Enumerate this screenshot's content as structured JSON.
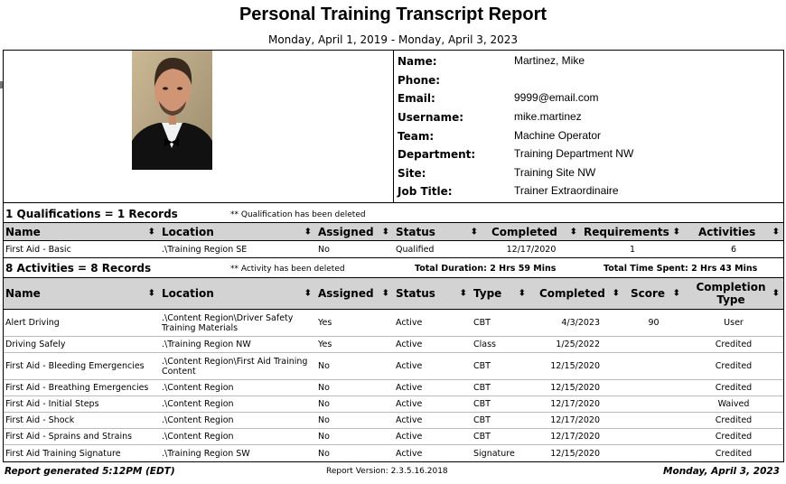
{
  "report": {
    "title": "Personal Training Transcript Report",
    "date_range": "Monday, April 1, 2019 - Monday, April 3, 2023"
  },
  "profile": {
    "fields": [
      {
        "label": "Name:",
        "value": "Martinez, Mike"
      },
      {
        "label": "Phone:",
        "value": ""
      },
      {
        "label": "Email:",
        "value": "9999@email.com"
      },
      {
        "label": "Username:",
        "value": "mike.martinez"
      },
      {
        "label": "Team:",
        "value": "Machine Operator"
      },
      {
        "label": "Department:",
        "value": "Training Department NW"
      },
      {
        "label": "Site:",
        "value": "Training Site NW"
      },
      {
        "label": "Job Title:",
        "value": "Trainer Extraordinaire"
      }
    ]
  },
  "qualifications": {
    "summary": "1 Qualifications = 1 Records",
    "note": "** Qualification has been deleted",
    "headers": [
      "Name",
      "Location",
      "Assigned",
      "Status",
      "Completed",
      "Requirements",
      "Activities"
    ],
    "rows": [
      {
        "name": "First Aid - Basic",
        "location": ".\\Training Region SE",
        "assigned": "No",
        "status": "Qualified",
        "completed": "12/17/2020",
        "requirements": "1",
        "activities": "6"
      }
    ]
  },
  "activities": {
    "summary": "8 Activities = 8 Records",
    "note": "** Activity has been deleted",
    "total_duration": "Total Duration: 2 Hrs 59 Mins",
    "total_time_spent": "Total Time Spent: 2 Hrs 43 Mins",
    "headers": [
      "Name",
      "Location",
      "Assigned",
      "Status",
      "Type",
      "Completed",
      "Score",
      "Completion Type"
    ],
    "rows": [
      {
        "name": "Alert Driving",
        "location": ".\\Content Region\\Driver Safety Training Materials",
        "assigned": "Yes",
        "status": "Active",
        "type": "CBT",
        "completed": "4/3/2023",
        "score": "90",
        "completion_type": "User"
      },
      {
        "name": "Driving Safely",
        "location": ".\\Training Region NW",
        "assigned": "Yes",
        "status": "Active",
        "type": "Class",
        "completed": "1/25/2022",
        "score": "",
        "completion_type": "Credited"
      },
      {
        "name": "First Aid - Bleeding Emergencies",
        "location": ".\\Content Region\\First Aid Training Content",
        "assigned": "No",
        "status": "Active",
        "type": "CBT",
        "completed": "12/15/2020",
        "score": "",
        "completion_type": "Credited"
      },
      {
        "name": "First Aid - Breathing Emergencies",
        "location": ".\\Content Region",
        "assigned": "No",
        "status": "Active",
        "type": "CBT",
        "completed": "12/15/2020",
        "score": "",
        "completion_type": "Credited"
      },
      {
        "name": "First Aid - Initial Steps",
        "location": ".\\Content Region",
        "assigned": "No",
        "status": "Active",
        "type": "CBT",
        "completed": "12/17/2020",
        "score": "",
        "completion_type": "Waived"
      },
      {
        "name": "First Aid - Shock",
        "location": ".\\Content Region",
        "assigned": "No",
        "status": "Active",
        "type": "CBT",
        "completed": "12/17/2020",
        "score": "",
        "completion_type": "Credited"
      },
      {
        "name": "First Aid - Sprains and Strains",
        "location": ".\\Content Region",
        "assigned": "No",
        "status": "Active",
        "type": "CBT",
        "completed": "12/17/2020",
        "score": "",
        "completion_type": "Credited"
      },
      {
        "name": "First Aid Training Signature",
        "location": ".\\Training Region SW",
        "assigned": "No",
        "status": "Active",
        "type": "Signature",
        "completed": "12/15/2020",
        "score": "",
        "completion_type": "Credited"
      }
    ]
  },
  "footer": {
    "generated": "Report generated 5:12PM (EDT)",
    "version": "Report Version: 2.3.5.16.2018",
    "date": "Monday, April 3, 2023"
  },
  "icons": {
    "sort": "sort-arrows-icon"
  },
  "colors": {
    "header_bg": "#d3d3d3",
    "border": "#000000"
  }
}
